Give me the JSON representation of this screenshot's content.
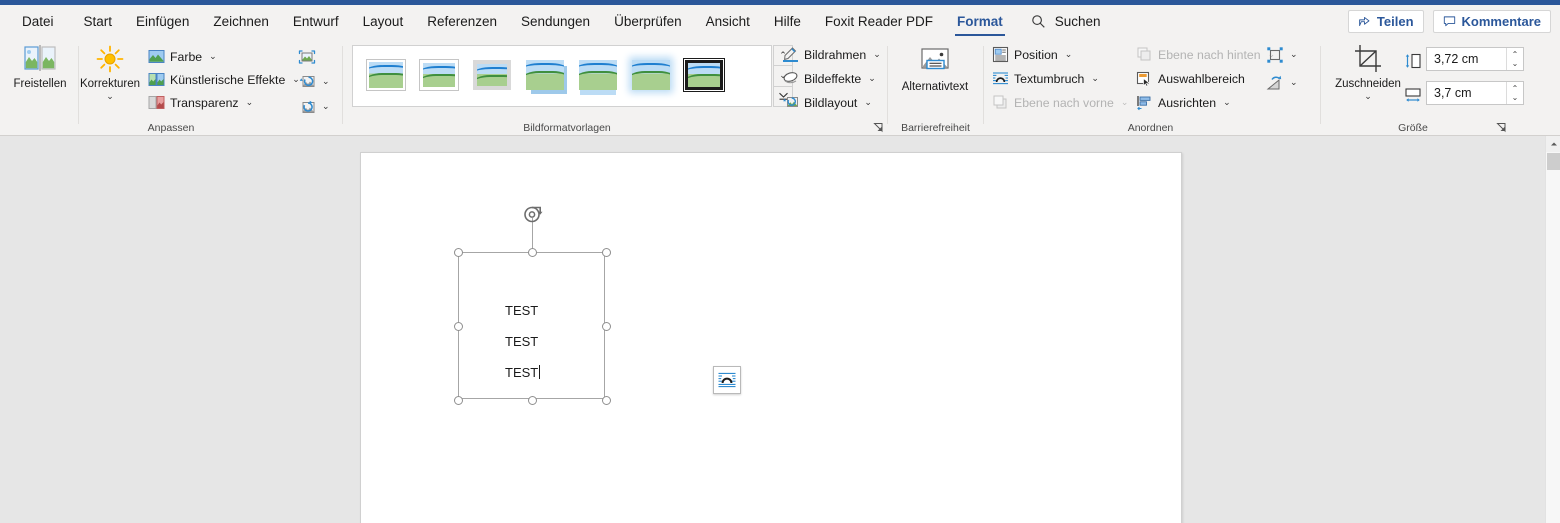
{
  "app": {
    "tabs": [
      {
        "label": "Datei",
        "active": false
      },
      {
        "label": "Start",
        "active": false
      },
      {
        "label": "Einfügen",
        "active": false
      },
      {
        "label": "Zeichnen",
        "active": false
      },
      {
        "label": "Entwurf",
        "active": false
      },
      {
        "label": "Layout",
        "active": false
      },
      {
        "label": "Referenzen",
        "active": false
      },
      {
        "label": "Sendungen",
        "active": false
      },
      {
        "label": "Überprüfen",
        "active": false
      },
      {
        "label": "Ansicht",
        "active": false
      },
      {
        "label": "Hilfe",
        "active": false
      },
      {
        "label": "Foxit Reader PDF",
        "active": false
      },
      {
        "label": "Format",
        "active": true
      }
    ],
    "search": {
      "label": "Suchen",
      "icon": "search-icon"
    },
    "share_button": {
      "label": "Teilen",
      "icon": "share-icon"
    },
    "comments_button": {
      "label": "Kommentare",
      "icon": "comment-icon"
    },
    "accent_color": "#2b579a"
  },
  "ribbon": {
    "groups": [
      {
        "name": "Anpassen",
        "label": "Anpassen"
      },
      {
        "name": "Bildformatvorlagen",
        "label": "Bildformatvorlagen"
      },
      {
        "name": "Barrierefreiheit",
        "label": "Barrierefreiheit"
      },
      {
        "name": "Anordnen",
        "label": "Anordnen"
      },
      {
        "name": "Größe",
        "label": "Größe"
      }
    ],
    "anpassen": {
      "remove_background": {
        "label": "Freistellen",
        "icon": "remove-background-icon"
      },
      "corrections": {
        "label": "Korrekturen",
        "icon": "corrections-sun-icon",
        "caret": "⌄"
      },
      "color": {
        "label": "Farbe",
        "icon": "picture-color-icon",
        "caret": "⌄"
      },
      "artistic_effects": {
        "label": "Künstlerische Effekte",
        "icon": "artistic-effects-icon",
        "caret": "⌄"
      },
      "transparency": {
        "label": "Transparenz",
        "icon": "transparency-icon",
        "caret": "⌄"
      },
      "compress": {
        "icon": "compress-pictures-icon"
      },
      "change_picture": {
        "icon": "change-picture-icon",
        "caret": "⌄"
      },
      "reset_picture": {
        "icon": "reset-picture-icon",
        "caret": "⌄"
      }
    },
    "bildformatvorlagen": {
      "styles": [
        {
          "name": "simple-frame-white"
        },
        {
          "name": "beveled-matte-white"
        },
        {
          "name": "metal-frame"
        },
        {
          "name": "drop-shadow-rectangle"
        },
        {
          "name": "reflected-rounded-rectangle"
        },
        {
          "name": "soft-edge-rectangle"
        },
        {
          "name": "thick-black-frame"
        }
      ],
      "selected_index": 6,
      "scroll_up": "⌃",
      "scroll_down": "⌄",
      "more": "⌄",
      "picture_border": {
        "label": "Bildrahmen",
        "icon": "picture-border-icon",
        "caret": "⌄"
      },
      "picture_effects": {
        "label": "Bildeffekte",
        "icon": "picture-effects-icon",
        "caret": "⌄"
      },
      "picture_layout": {
        "label": "Bildlayout",
        "icon": "picture-layout-icon",
        "caret": "⌄"
      },
      "dialog_launcher": "◢"
    },
    "barrierefreiheit": {
      "alt_text": {
        "label": "Alternativtext",
        "icon": "alt-text-icon"
      }
    },
    "anordnen": {
      "position": {
        "label": "Position",
        "icon": "position-icon",
        "caret": "⌄",
        "disabled": false
      },
      "wrap_text": {
        "label": "Textumbruch",
        "icon": "wrap-text-icon",
        "caret": "⌄",
        "disabled": false
      },
      "bring_forward": {
        "label": "Ebene nach vorne",
        "icon": "bring-forward-icon",
        "caret": "⌄",
        "disabled": true
      },
      "send_backward": {
        "label": "Ebene nach hinten",
        "icon": "send-backward-icon",
        "caret": "⌄",
        "disabled": true
      },
      "selection_pane": {
        "label": "Auswahlbereich",
        "icon": "selection-pane-icon",
        "disabled": false
      },
      "align": {
        "label": "Ausrichten",
        "icon": "align-objects-icon",
        "caret": "⌄",
        "disabled": false
      },
      "group": {
        "icon": "group-objects-icon",
        "caret": "⌄",
        "disabled": false
      },
      "rotate": {
        "icon": "rotate-objects-icon",
        "caret": "⌄",
        "disabled": false
      }
    },
    "groesse": {
      "crop": {
        "label": "Zuschneiden",
        "icon": "crop-icon",
        "caret": "⌄"
      },
      "height": {
        "icon": "shape-height-icon",
        "value": "3,72 cm",
        "up": "⌃",
        "down": "⌄"
      },
      "width": {
        "icon": "shape-width-icon",
        "value": "3,7 cm",
        "up": "⌃",
        "down": "⌄"
      },
      "dialog_launcher": "◢"
    },
    "collapse_ribbon": "⌃"
  },
  "document": {
    "selected_object": {
      "rotate_handle": "rotate-handle-icon",
      "layout_options": {
        "icon": "layout-options-icon"
      },
      "text_lines": [
        "TEST",
        "TEST",
        "TEST"
      ]
    }
  },
  "scrollbar": {
    "up_arrow": "⌃",
    "thumb": "scroll-thumb"
  }
}
